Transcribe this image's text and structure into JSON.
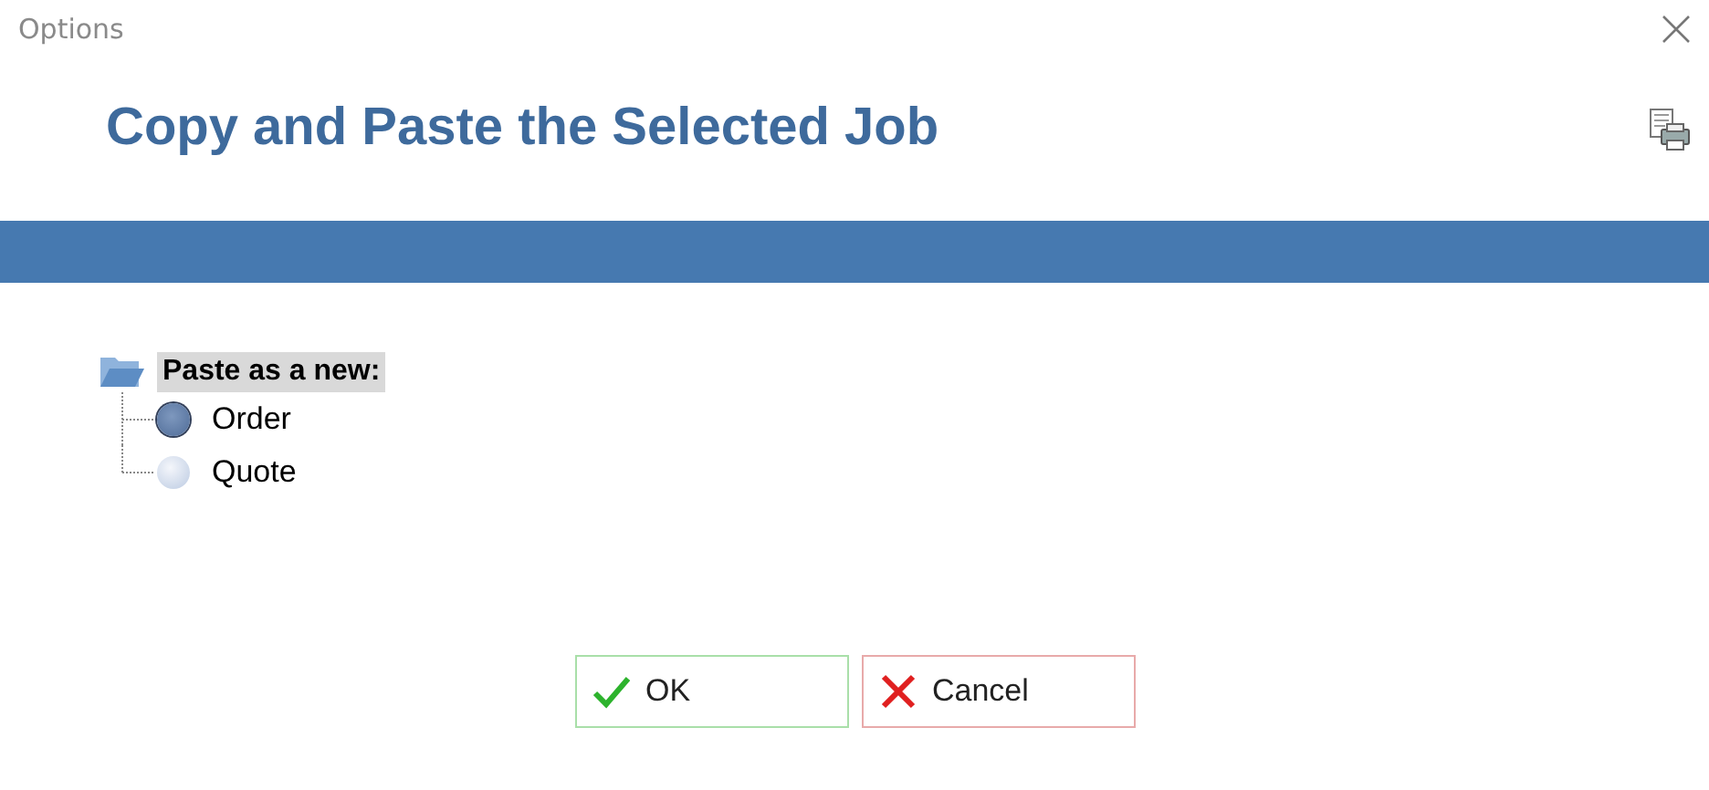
{
  "window": {
    "title": "Options"
  },
  "heading": "Copy and Paste the Selected Job",
  "tree": {
    "label": "Paste as a new:",
    "selected": true,
    "children": [
      {
        "label": "Order",
        "selected": true
      },
      {
        "label": "Quote",
        "selected": false
      }
    ]
  },
  "buttons": [
    {
      "label": "OK",
      "kind": "ok"
    },
    {
      "label": "Cancel",
      "kind": "cancel"
    }
  ]
}
